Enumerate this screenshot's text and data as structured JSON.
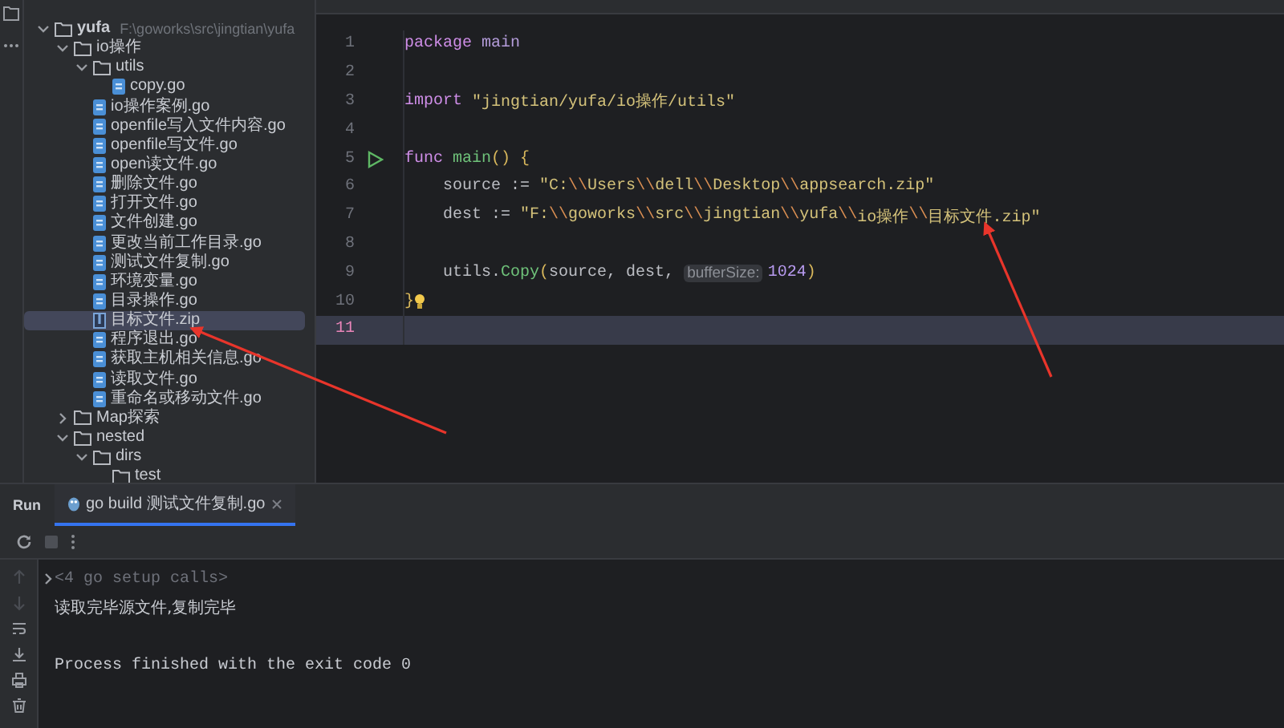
{
  "project_tree": [
    {
      "label": "yufa",
      "path": "F:\\goworks\\src\\jingtian\\yufa",
      "kind": "folder",
      "expanded": true,
      "selected": false,
      "children": [
        {
          "label": "io操作",
          "kind": "folder",
          "expanded": true,
          "selected": false,
          "children": [
            {
              "label": "utils",
              "kind": "folder",
              "expanded": true,
              "selected": false,
              "children": [
                {
                  "label": "copy.go",
                  "kind": "go",
                  "selected": false
                }
              ]
            },
            {
              "label": "io操作案例.go",
              "kind": "go",
              "selected": false
            },
            {
              "label": "openfile写入文件内容.go",
              "kind": "go",
              "selected": false
            },
            {
              "label": "openfile写文件.go",
              "kind": "go",
              "selected": false
            },
            {
              "label": "open读文件.go",
              "kind": "go",
              "selected": false
            },
            {
              "label": "删除文件.go",
              "kind": "go",
              "selected": false
            },
            {
              "label": "打开文件.go",
              "kind": "go",
              "selected": false
            },
            {
              "label": "文件创建.go",
              "kind": "go",
              "selected": false
            },
            {
              "label": "更改当前工作目录.go",
              "kind": "go",
              "selected": false
            },
            {
              "label": "测试文件复制.go",
              "kind": "go",
              "selected": false
            },
            {
              "label": "环境变量.go",
              "kind": "go",
              "selected": false
            },
            {
              "label": "目录操作.go",
              "kind": "go",
              "selected": false
            },
            {
              "label": "目标文件.zip",
              "kind": "zip",
              "selected": true
            },
            {
              "label": "程序退出.go",
              "kind": "go",
              "selected": false
            },
            {
              "label": "获取主机相关信息.go",
              "kind": "go",
              "selected": false
            },
            {
              "label": "读取文件.go",
              "kind": "go",
              "selected": false
            },
            {
              "label": "重命名或移动文件.go",
              "kind": "go",
              "selected": false
            }
          ]
        },
        {
          "label": "Map探索",
          "kind": "folder",
          "expanded": false,
          "selected": false
        },
        {
          "label": "nested",
          "kind": "folder",
          "expanded": true,
          "selected": false,
          "children": [
            {
              "label": "dirs",
              "kind": "folder",
              "expanded": true,
              "selected": false,
              "children": [
                {
                  "label": "test",
                  "kind": "folder",
                  "selected": false
                }
              ]
            }
          ]
        }
      ]
    }
  ],
  "editor": {
    "lines": [
      {
        "number": "1",
        "current": false,
        "run_button": false,
        "lightbulb": false,
        "tokens": [
          {
            "kind": "keyword",
            "text": "package"
          },
          {
            "kind": "name",
            "text": " main"
          }
        ]
      },
      {
        "number": "2",
        "current": false,
        "run_button": false,
        "lightbulb": false
      },
      {
        "number": "3",
        "current": false,
        "run_button": false,
        "lightbulb": false,
        "tokens": [
          {
            "kind": "keyword",
            "text": "import"
          },
          {
            "kind": "string",
            "text": " \"jingtian/yufa/io操作/utils\""
          }
        ]
      },
      {
        "number": "4",
        "current": false,
        "run_button": false,
        "lightbulb": false
      },
      {
        "number": "5",
        "current": false,
        "run_button": true,
        "lightbulb": false,
        "tokens": [
          {
            "kind": "keyword",
            "text": "func"
          },
          {
            "kind": "function",
            "text": " main"
          },
          {
            "kind": "paren",
            "text": "() {"
          }
        ]
      },
      {
        "number": "6",
        "current": false,
        "run_button": false,
        "lightbulb": false,
        "tokens": [
          {
            "kind": "plain",
            "text": "    source := "
          },
          {
            "kind": "string",
            "text": "\"C:"
          },
          {
            "kind": "escape",
            "text": "\\\\"
          },
          {
            "kind": "string",
            "text": "Users"
          },
          {
            "kind": "escape",
            "text": "\\\\"
          },
          {
            "kind": "string",
            "text": "dell"
          },
          {
            "kind": "escape",
            "text": "\\\\"
          },
          {
            "kind": "string",
            "text": "Desktop"
          },
          {
            "kind": "escape",
            "text": "\\\\"
          },
          {
            "kind": "string",
            "text": "appsearch.zip\""
          }
        ]
      },
      {
        "number": "7",
        "current": false,
        "run_button": false,
        "lightbulb": false,
        "tokens": [
          {
            "kind": "plain",
            "text": "    dest := "
          },
          {
            "kind": "string",
            "text": "\"F:"
          },
          {
            "kind": "escape",
            "text": "\\\\"
          },
          {
            "kind": "string",
            "text": "goworks"
          },
          {
            "kind": "escape",
            "text": "\\\\"
          },
          {
            "kind": "string",
            "text": "src"
          },
          {
            "kind": "escape",
            "text": "\\\\"
          },
          {
            "kind": "string",
            "text": "jingtian"
          },
          {
            "kind": "escape",
            "text": "\\\\"
          },
          {
            "kind": "string",
            "text": "yufa"
          },
          {
            "kind": "escape",
            "text": "\\\\"
          },
          {
            "kind": "string",
            "text": "io操作"
          },
          {
            "kind": "escape",
            "text": "\\\\"
          },
          {
            "kind": "string",
            "text": "目标文件.zip\""
          }
        ]
      },
      {
        "number": "8",
        "current": false,
        "run_button": false,
        "lightbulb": false
      },
      {
        "number": "9",
        "current": false,
        "run_button": false,
        "lightbulb": false,
        "tokens": [
          {
            "kind": "plain",
            "text": "    utils."
          },
          {
            "kind": "function",
            "text": "Copy"
          },
          {
            "kind": "paren",
            "text": "("
          },
          {
            "kind": "plain",
            "text": "source, dest, "
          },
          {
            "kind": "hint",
            "text": "bufferSize:"
          },
          {
            "kind": "number",
            "text": "1024"
          },
          {
            "kind": "paren",
            "text": ")"
          }
        ]
      },
      {
        "number": "10",
        "current": false,
        "run_button": false,
        "lightbulb": true,
        "tokens": [
          {
            "kind": "paren",
            "text": "}"
          }
        ]
      },
      {
        "number": "11",
        "current": true,
        "run_button": false,
        "lightbulb": false
      }
    ]
  },
  "run_panel": {
    "title": "Run",
    "tabs": [
      {
        "label": "go build 测试文件复制.go",
        "selected": true
      }
    ],
    "console": [
      {
        "kind": "fold",
        "text": "<4 go setup calls>"
      },
      {
        "kind": "output",
        "text": "读取完毕源文件,复制完毕"
      },
      {
        "kind": "blank"
      },
      {
        "kind": "output",
        "text": "Process finished with the exit code 0"
      }
    ]
  }
}
